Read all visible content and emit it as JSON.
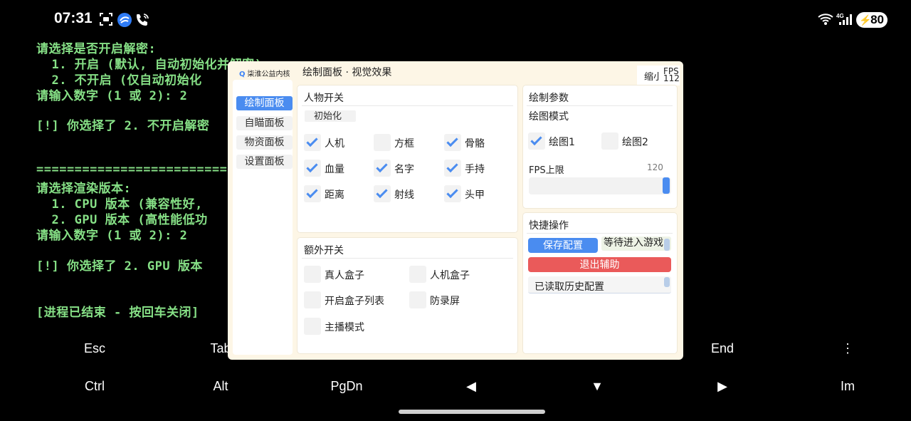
{
  "status_bar": {
    "time": "07:31",
    "battery": "80",
    "left_icons": [
      "screenshot-icon",
      "app-icon",
      "wifi-call-icon"
    ],
    "right_icons": [
      "wifi-icon",
      "signal-4g-icon"
    ]
  },
  "terminal": {
    "lines": [
      "请选择是否开启解密:",
      "  1. 开启 (默认, 自动初始化并解密)",
      "  2. 不开启 (仅自动初始化",
      "请输入数字 (1 或 2): 2",
      "",
      "[!] 你选择了 2. 不开启解密",
      "",
      "",
      "==============================",
      "请选择渲染版本:",
      "  1. CPU 版本 (兼容性好,",
      "  2. GPU 版本 (高性能低功",
      "请输入数字 (1 或 2): 2",
      "",
      "[!] 你选择了 2. GPU 版本",
      "",
      "",
      "[进程已结束 - 按回车关闭]"
    ]
  },
  "extra_keys": {
    "row1": [
      "Esc",
      "Tab",
      "",
      "",
      "",
      "",
      "",
      "End",
      "⋮"
    ],
    "row2": [
      "Ctrl",
      "Alt",
      "PgDn",
      "◀",
      "▼",
      "▶",
      "Im"
    ]
  },
  "panel": {
    "brand": "柒淮公益内核",
    "title": "绘制面板 · 视觉效果",
    "shrink": "缩小",
    "fps_label": "FPS",
    "fps_value": "112",
    "nav": [
      "绘制面板",
      "自瞄面板",
      "物资面板",
      "设置面板"
    ],
    "character_switches": {
      "title": "人物开关",
      "init_button": "初始化",
      "items": [
        {
          "label": "人机",
          "checked": true
        },
        {
          "label": "方框",
          "checked": false
        },
        {
          "label": "骨骼",
          "checked": true
        },
        {
          "label": "血量",
          "checked": true
        },
        {
          "label": "名字",
          "checked": true
        },
        {
          "label": "手持",
          "checked": true
        },
        {
          "label": "距离",
          "checked": true
        },
        {
          "label": "射线",
          "checked": true
        },
        {
          "label": "头甲",
          "checked": true
        }
      ]
    },
    "extra_switches": {
      "title": "额外开关",
      "items": [
        {
          "label": "真人盒子",
          "checked": false
        },
        {
          "label": "人机盒子",
          "checked": false
        },
        {
          "label": "开启盒子列表",
          "checked": false
        },
        {
          "label": "防录屏",
          "checked": false
        },
        {
          "label": "主播模式",
          "checked": false
        }
      ]
    },
    "draw_params": {
      "title": "绘制参数",
      "mode_label": "绘图模式",
      "modes": [
        {
          "label": "绘图1",
          "checked": true
        },
        {
          "label": "绘图2",
          "checked": false
        }
      ],
      "fps_limit_label": "FPS上限",
      "fps_limit_value": "120",
      "fps_limit_fraction": 1.0
    },
    "quick_actions": {
      "title": "快捷操作",
      "save_button": "保存配置",
      "waiting_text": "等待进入游戏",
      "exit_button": "退出辅助",
      "log_text": "已读取历史配置"
    }
  }
}
